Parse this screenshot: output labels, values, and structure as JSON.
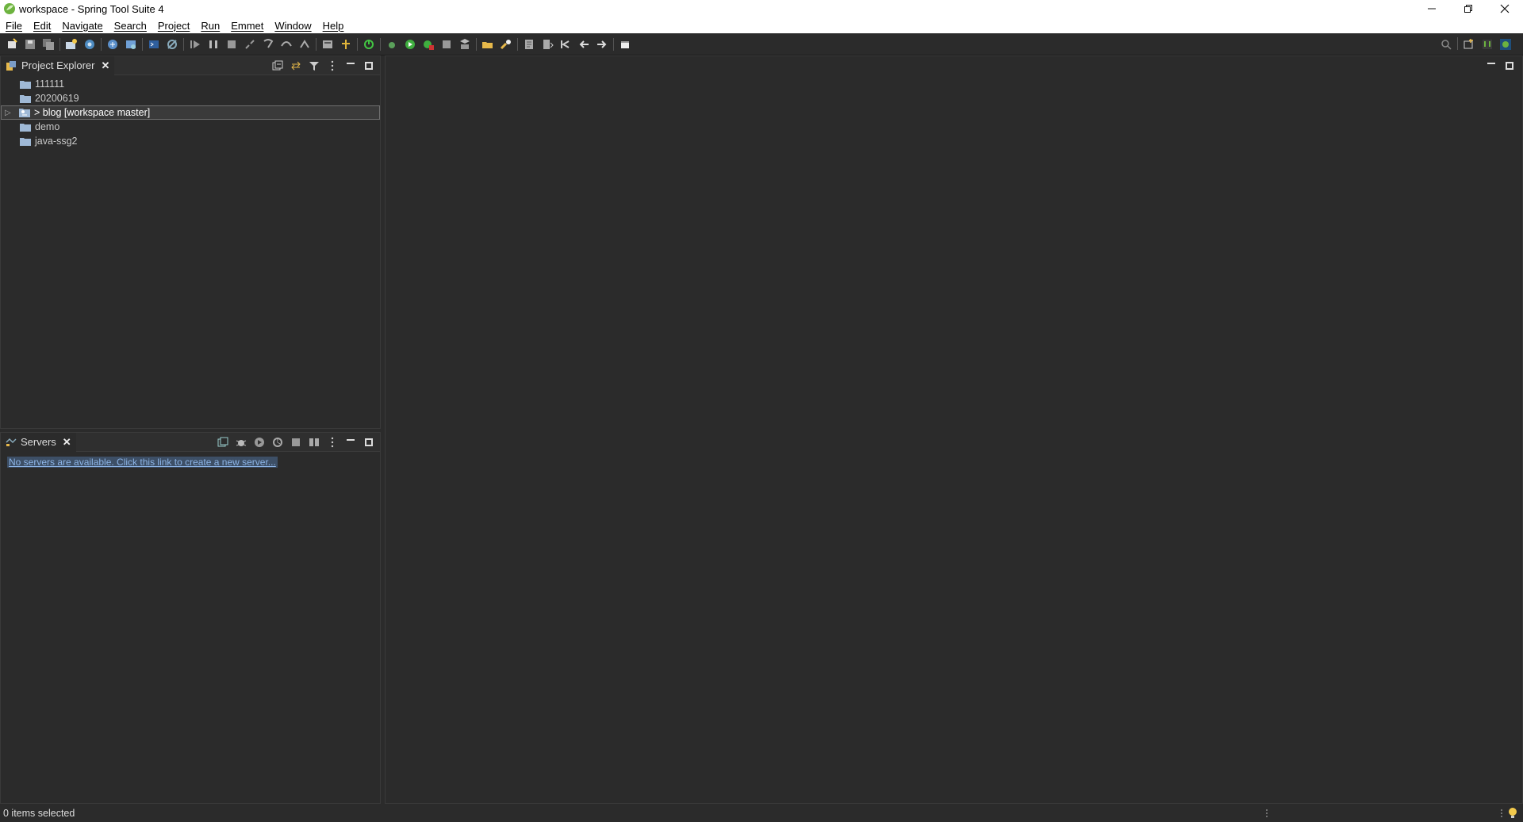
{
  "window": {
    "title": "workspace - Spring Tool Suite 4",
    "controls": [
      "minimize",
      "restore",
      "close"
    ]
  },
  "menubar": {
    "items": [
      {
        "label": "File"
      },
      {
        "label": "Edit"
      },
      {
        "label": "Navigate"
      },
      {
        "label": "Search"
      },
      {
        "label": "Project"
      },
      {
        "label": "Run"
      },
      {
        "label": "Emmet"
      },
      {
        "label": "Window"
      },
      {
        "label": "Help"
      }
    ]
  },
  "project_explorer": {
    "tab_label": "Project Explorer",
    "tree": [
      {
        "label": "111111"
      },
      {
        "label": "20200619"
      },
      {
        "label": "> blog [workspace master]"
      },
      {
        "label": "demo"
      },
      {
        "label": "java-ssg2"
      }
    ]
  },
  "servers": {
    "tab_label": "Servers",
    "empty_link": "No servers are available. Click this link to create a new server..."
  },
  "status": {
    "text": "0 items selected"
  },
  "colors": {
    "background": "#2b2b2b",
    "folder": "#9fb9d6",
    "link": "#8cb4e6",
    "brand_green": "#6db33f"
  }
}
